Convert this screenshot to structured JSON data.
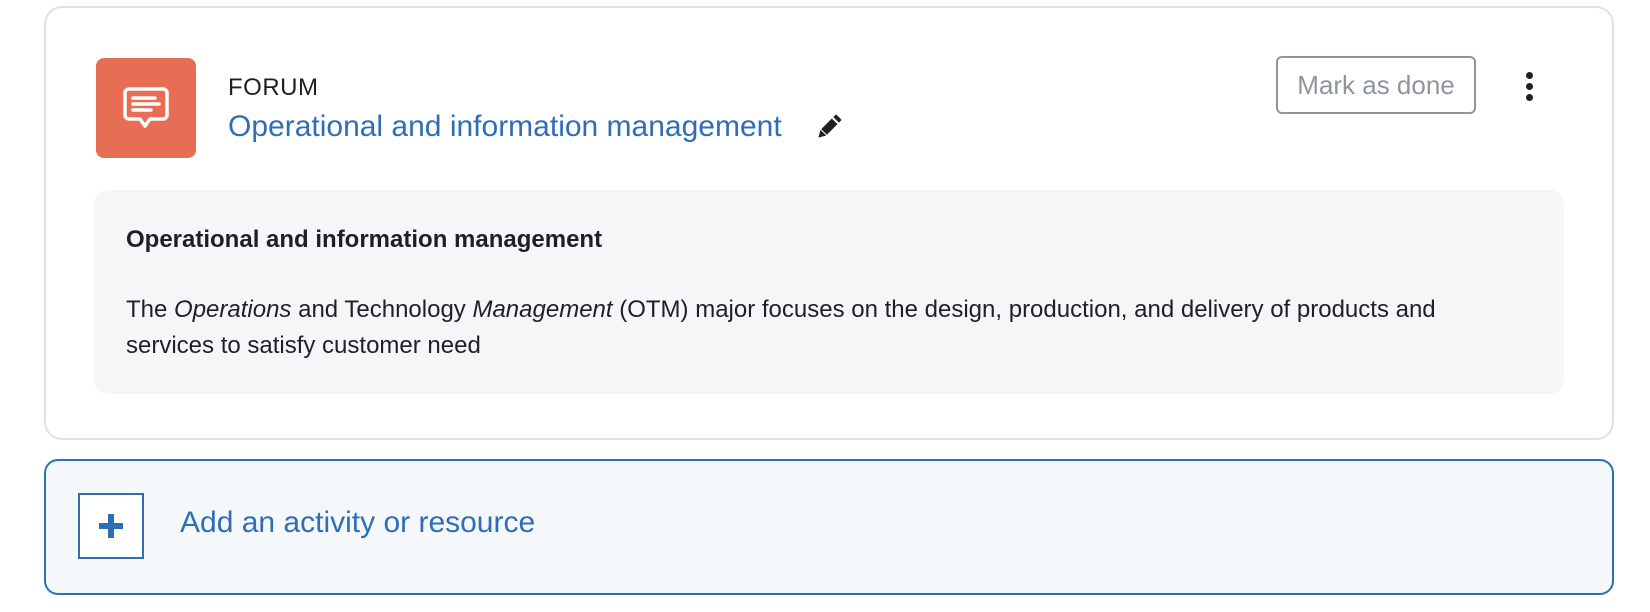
{
  "activity": {
    "type_label": "FORUM",
    "title_link": "Operational and information management",
    "icon": "forum-chat-icon",
    "icon_bg_color": "#e76e55",
    "edit_icon": "pencil-icon",
    "mark_done_label": "Mark as done",
    "menu_icon": "kebab-menu-icon"
  },
  "description": {
    "title": "Operational and information management",
    "text_parts": {
      "p1": "The ",
      "p2": "Operations",
      "p3": " and Technology ",
      "p4": "Management",
      "p5": " (OTM) major focuses on the design, production, and delivery of products and services to satisfy customer need"
    }
  },
  "add_activity": {
    "label": "Add an activity or resource",
    "icon": "plus-icon",
    "accent_color": "#2f6db5"
  }
}
